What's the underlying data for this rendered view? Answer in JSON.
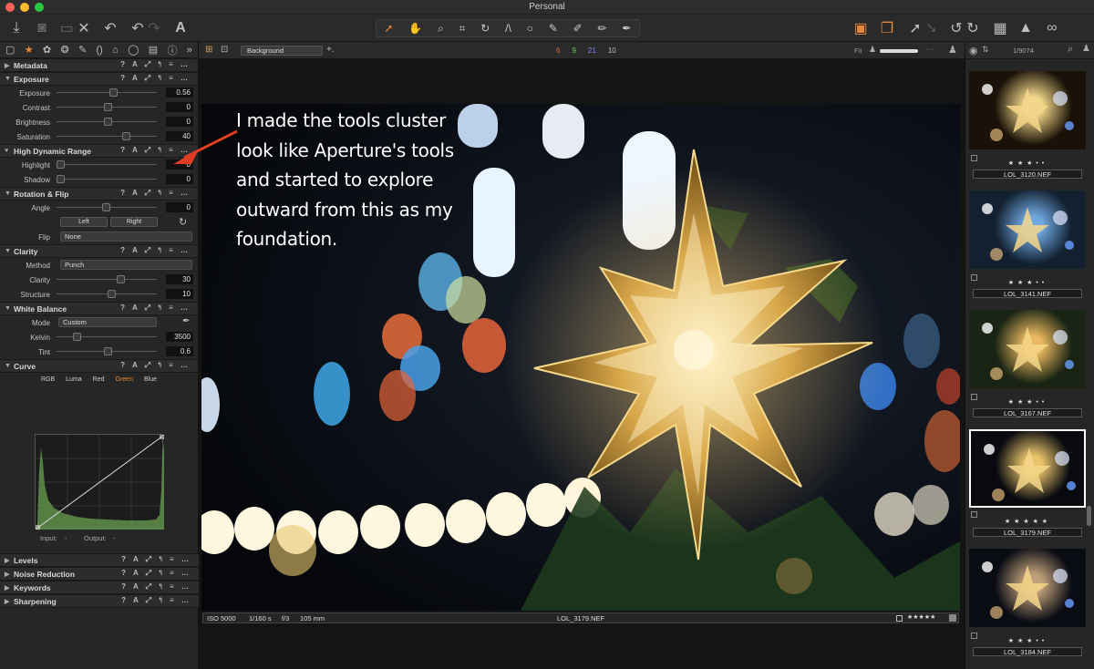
{
  "window": {
    "title": "Personal"
  },
  "toolbar": {
    "left_icons": [
      "import-icon",
      "camera-icon",
      "camera-off-icon",
      "reset-icon",
      "undo-icon",
      "redo-icon",
      "text-icon"
    ],
    "right_icons": [
      "edit-icon",
      "variants-icon",
      "cursor-up-icon",
      "undo-rotate-icon",
      "redo-rotate-icon",
      "grid-icon",
      "warning-icon",
      "glasses-icon"
    ]
  },
  "viewer": {
    "background_label": "Background",
    "counts": [
      "6",
      "9",
      "21",
      "10"
    ],
    "count_colors": [
      "#e06a4a",
      "#6acb5c",
      "#7a8aff",
      "#bbbbbb"
    ],
    "fit_label": "Fit"
  },
  "tools": {
    "metadata": "Metadata",
    "exposure": {
      "title": "Exposure",
      "rows": [
        {
          "label": "Exposure",
          "value": "0.56"
        },
        {
          "label": "Contrast",
          "value": "0"
        },
        {
          "label": "Brightness",
          "value": "0"
        },
        {
          "label": "Saturation",
          "value": "40"
        }
      ]
    },
    "hdr": {
      "title": "High Dynamic Range",
      "rows": [
        {
          "label": "Highlight",
          "value": "0"
        },
        {
          "label": "Shadow",
          "value": "0"
        }
      ]
    },
    "rotation": {
      "title": "Rotation & Flip",
      "angle_label": "Angle",
      "angle_value": "0",
      "left": "Left",
      "right": "Right",
      "flip_label": "Flip",
      "flip_value": "None"
    },
    "clarity": {
      "title": "Clarity",
      "method_label": "Method",
      "method_value": "Punch",
      "rows": [
        {
          "label": "Clarity",
          "value": "30"
        },
        {
          "label": "Structure",
          "value": "10"
        }
      ]
    },
    "white_balance": {
      "title": "White Balance",
      "mode_label": "Mode",
      "mode_value": "Custom",
      "rows": [
        {
          "label": "Kelvin",
          "value": "3500"
        },
        {
          "label": "Tint",
          "value": "0.6"
        }
      ]
    },
    "curve": {
      "title": "Curve",
      "tabs": [
        "RGB",
        "Luma",
        "Red",
        "Green",
        "Blue"
      ],
      "active_tab": "Green",
      "input_label": "Input:",
      "input_value": "-",
      "output_label": "Output:",
      "output_value": "-"
    },
    "collapsed": [
      "Levels",
      "Noise Reduction",
      "Keywords",
      "Sharpening"
    ]
  },
  "annotation": {
    "lines": [
      "I made the tools cluster",
      "look like Aperture's tools",
      "and started to explore",
      "outward from this as my",
      "foundation."
    ]
  },
  "info": {
    "iso": "ISO 5000",
    "shutter": "1/160 s",
    "aperture": "f/3",
    "focal": "105 mm",
    "filename": "LOL_3179.NEF",
    "rating": "★★★★★"
  },
  "browser": {
    "counter": "1/9074",
    "items": [
      {
        "rating": "★ ★ ★ • •",
        "name": "LOL_3120.NEF"
      },
      {
        "rating": "★ ★ ★ • •",
        "name": "LOL_3141.NEF"
      },
      {
        "rating": "★ ★ ★ • •",
        "name": "LOL_3167.NEF"
      },
      {
        "rating": "★ ★ ★ ★ ★",
        "name": "LOL_3179.NEF",
        "selected": true
      },
      {
        "rating": "★ ★ ★ • •",
        "name": "LOL_3184.NEF"
      }
    ]
  }
}
